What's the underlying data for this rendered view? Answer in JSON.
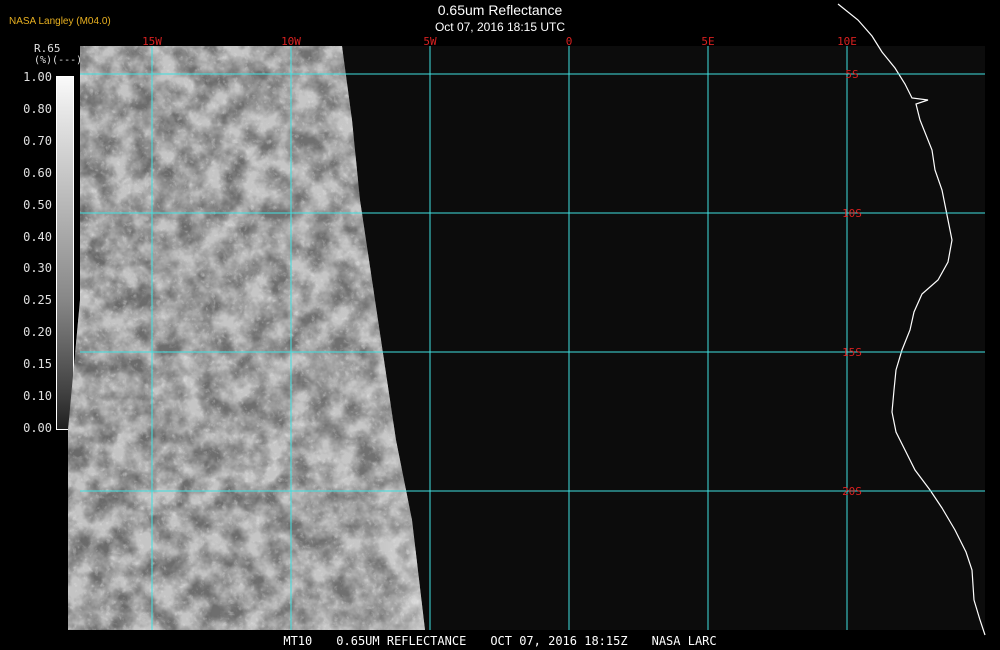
{
  "header": {
    "title": "0.65um Reflectance",
    "datetime": "Oct 07, 2016 18:15 UTC",
    "org": "NASA Langley (M04.0)"
  },
  "colorbar": {
    "variable": "R.65",
    "unit": "(%)(---)",
    "ticks": [
      "1.00",
      "0.80",
      "0.70",
      "0.60",
      "0.50",
      "0.40",
      "0.30",
      "0.25",
      "0.20",
      "0.15",
      "0.10",
      "0.00"
    ]
  },
  "map": {
    "longitude_labels": [
      "15W",
      "10W",
      "5W",
      "0",
      "5E",
      "10E"
    ],
    "latitude_labels": [
      "5S",
      "10S",
      "15S",
      "20S"
    ],
    "grid_color": "#40e0e0",
    "label_lon_color": "#d82020",
    "label_lat_color": "#d82020",
    "coastline_color": "#ffffff",
    "background_color": "#0c0c0c"
  },
  "footer": {
    "sat": "MT10",
    "product": "0.65UM REFLECTANCE",
    "date": "OCT 07, 2016 18:15Z",
    "agency": "NASA LARC"
  }
}
